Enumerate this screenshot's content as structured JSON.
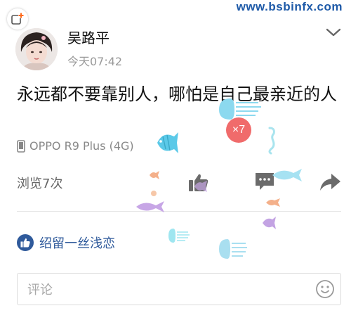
{
  "header": {
    "watermark": "www.bsbinfx.com",
    "add_icon": "add-plus-icon",
    "chevron_icon": "chevron-down-icon"
  },
  "post": {
    "username": "吴路平",
    "timestamp": "今天07:42",
    "content": "永远都不要靠别人，哪怕是自己最亲近的人",
    "device": "OPPO R9 Plus (4G)"
  },
  "stats": {
    "views": "浏览7次",
    "like_icon": "thumbs-up-icon",
    "comment_icon": "comment-bubble-icon",
    "share_icon": "share-arrow-icon"
  },
  "likes": {
    "names": "绍留一丝浅恋"
  },
  "reaction_badge": "×7",
  "comment": {
    "placeholder": "评论",
    "emoji_icon": "smiley-icon"
  },
  "colors": {
    "accent": "#2f5a9b",
    "watermark": "#1e5aa8",
    "badge": "#f06b6b",
    "muted": "#999999"
  }
}
